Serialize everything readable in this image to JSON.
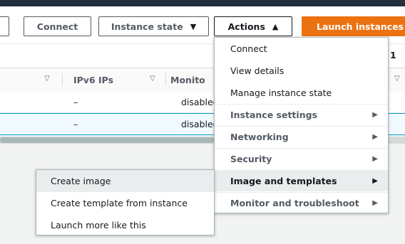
{
  "toolbar": {
    "connect_label": "Connect",
    "instance_state_label": "Instance state",
    "actions_label": "Actions",
    "launch_label": "Launch instances",
    "caret_down": "▼",
    "caret_up": "▲"
  },
  "pagination": {
    "page": "1"
  },
  "table": {
    "columns": [
      "IPv6 IPs",
      "Monito"
    ],
    "rows": [
      {
        "ipv6": "–",
        "monitoring": "disabled"
      },
      {
        "ipv6": "–",
        "monitoring": "disabled"
      }
    ]
  },
  "actions_menu": {
    "items": [
      {
        "label": "Connect"
      },
      {
        "label": "View details"
      },
      {
        "label": "Manage instance state"
      },
      {
        "label": "Instance settings"
      },
      {
        "label": "Networking"
      },
      {
        "label": "Security"
      },
      {
        "label": "Image and templates"
      },
      {
        "label": "Monitor and troubleshoot"
      }
    ],
    "submenu_arrow": "▶"
  },
  "image_submenu": {
    "items": [
      {
        "label": "Create image"
      },
      {
        "label": "Create template from instance"
      },
      {
        "label": "Launch more like this"
      }
    ]
  },
  "colors": {
    "accent_orange": "#ec7211",
    "header_dark": "#232f3e",
    "selection_blue": "#00a1c9"
  }
}
